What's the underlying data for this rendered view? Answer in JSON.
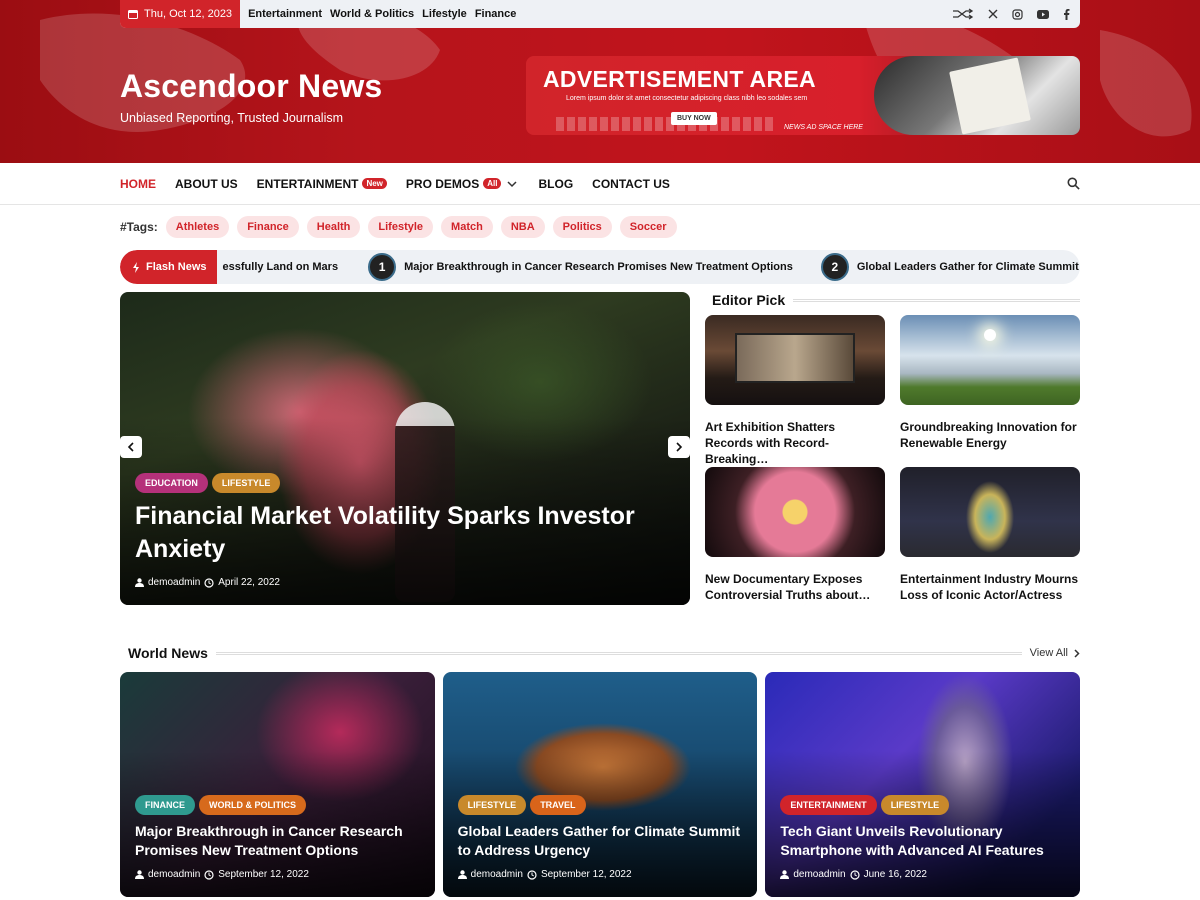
{
  "topbar": {
    "date": "Thu, Oct 12, 2023",
    "links": [
      "Entertainment",
      "World & Politics",
      "Lifestyle",
      "Finance"
    ],
    "social_icons": [
      "shuffle-icon",
      "x-icon",
      "instagram-icon",
      "youtube-icon",
      "facebook-icon"
    ]
  },
  "brand": {
    "title": "Ascendoor News",
    "tagline": "Unbiased Reporting, Trusted Journalism"
  },
  "ad": {
    "title": "ADVERTISEMENT AREA",
    "subtitle": "Lorem ipsum dolor sit amet consectetur adipiscing class nibh leo sodales sem",
    "button": "BUY NOW",
    "note": "NEWS AD SPACE HERE"
  },
  "nav": {
    "items": [
      {
        "label": "HOME"
      },
      {
        "label": "ABOUT US"
      },
      {
        "label": "ENTERTAINMENT",
        "badge": "New"
      },
      {
        "label": "PRO DEMOS",
        "badge": "All"
      },
      {
        "label": "BLOG"
      },
      {
        "label": "CONTACT US"
      }
    ]
  },
  "tags": {
    "label": "#Tags:",
    "items": [
      "Athletes",
      "Finance",
      "Health",
      "Lifestyle",
      "Match",
      "NBA",
      "Politics",
      "Soccer"
    ]
  },
  "flash": {
    "label": "Flash News",
    "partial": "essfully Land on Mars",
    "items": [
      {
        "num": "1",
        "text": "Major Breakthrough in Cancer Research Promises New Treatment Options"
      },
      {
        "num": "2",
        "text": "Global Leaders Gather for Climate Summit to Address Urger"
      }
    ]
  },
  "hero": {
    "cats": [
      "EDUCATION",
      "LIFESTYLE"
    ],
    "title": "Financial Market Volatility Sparks Investor Anxiety",
    "author": "demoadmin",
    "date": "April 22, 2022"
  },
  "editor": {
    "heading": "Editor Pick",
    "items": [
      {
        "title": "Art Exhibition Shatters Records with Record-Breaking…"
      },
      {
        "title": "Groundbreaking Innovation for Renewable Energy"
      },
      {
        "title": "New Documentary Exposes Controversial Truths about…"
      },
      {
        "title": "Entertainment Industry Mourns Loss of Iconic Actor/Actress"
      }
    ]
  },
  "world": {
    "heading": "World News",
    "view_all": "View All",
    "items": [
      {
        "cats": [
          "FINANCE",
          "WORLD & POLITICS"
        ],
        "title": "Major Breakthrough in Cancer Research Promises New Treatment Options",
        "author": "demoadmin",
        "date": "September 12, 2022"
      },
      {
        "cats": [
          "LIFESTYLE",
          "TRAVEL"
        ],
        "title": "Global Leaders Gather for Climate Summit to Address Urgency",
        "author": "demoadmin",
        "date": "September 12, 2022"
      },
      {
        "cats": [
          "ENTERTAINMENT",
          "LIFESTYLE"
        ],
        "title": "Tech Giant Unveils Revolutionary Smartphone with Advanced AI Features",
        "author": "demoadmin",
        "date": "June 16, 2022"
      }
    ]
  },
  "colors": {
    "accent": "#d1242a",
    "education": "#b5317a",
    "lifestyle": "#c8892b",
    "finance": "#2f9a8f",
    "politics": "#d76a1c",
    "travel": "#d9641a",
    "entertainment": "#d1242a"
  }
}
